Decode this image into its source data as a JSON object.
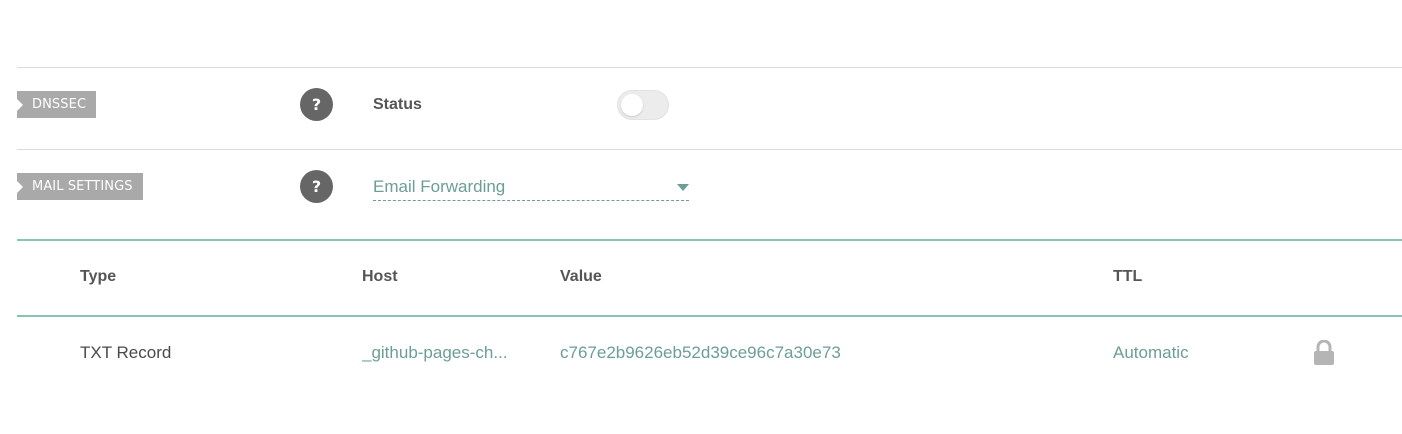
{
  "dnssec": {
    "tag_label": "DNSSEC",
    "help_glyph": "?",
    "status_label": "Status",
    "toggle_state": "off"
  },
  "mail_settings": {
    "tag_label": "MAIL SETTINGS",
    "help_glyph": "?",
    "selected_option": "Email Forwarding"
  },
  "records_table": {
    "columns": [
      "Type",
      "Host",
      "Value",
      "TTL"
    ],
    "rows": [
      {
        "type": "TXT Record",
        "host": "_github-pages-ch...",
        "value": "c767e2b9626eb52d39ce96c7a30e73",
        "ttl": "Automatic",
        "lock_icon": "lock-icon"
      }
    ]
  },
  "colors": {
    "accent_teal": "#6b9e95",
    "divider_teal": "#87c3b8",
    "tag_gray": "#a9a9a9",
    "help_gray": "#666666"
  }
}
